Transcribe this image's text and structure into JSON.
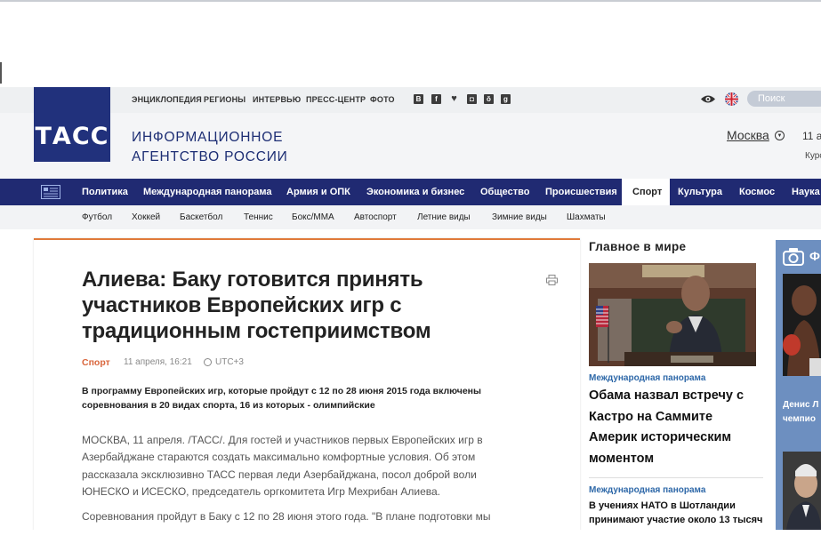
{
  "header": {
    "logo_text": "ТАСС",
    "agency_line1": "ИНФОРМАЦИОННОЕ",
    "agency_line2": "АГЕНТСТВО РОССИИ",
    "top_links": [
      "ЭНЦИКЛОПЕДИЯ",
      "РЕГИОНЫ",
      "ИНТЕРВЬЮ",
      "ПРЕСС-ЦЕНТР",
      "ФОТО"
    ],
    "social_icons": [
      "vk-icon",
      "facebook-icon",
      "twitter-icon",
      "instagram-icon",
      "odnoklassniki-icon",
      "google-plus-icon"
    ],
    "search_placeholder": "Поиск",
    "city": "Москва",
    "date": "11 а",
    "rates": "Курс"
  },
  "nav": {
    "items": [
      "Политика",
      "Международная панорама",
      "Армия и ОПК",
      "Экономика и бизнес",
      "Общество",
      "Происшествия",
      "Спорт",
      "Культура",
      "Космос",
      "Наука"
    ],
    "active": "Спорт"
  },
  "subnav": {
    "items": [
      "Футбол",
      "Хоккей",
      "Баскетбол",
      "Теннис",
      "Бокс/ММА",
      "Автоспорт",
      "Летние виды",
      "Зимние виды",
      "Шахматы"
    ]
  },
  "article": {
    "title": "Алиева: Баку готовится принять участников Европейских игр с традиционным гостеприимством",
    "category": "Спорт",
    "date": "11 апреля, 16:21",
    "timezone": "UTC+3",
    "lead": "В программу Европейских игр, которые пройдут с 12 по 28 июня 2015 года включены соревнования в 20 видах спорта, 16 из которых - олимпийские",
    "paragraph1": "МОСКВА, 11 апреля. /ТАСС/. Для гостей и участников первых Европейских игр в Азербайджане стараются создать максимально комфортные условия. Об этом рассказала эксклюзивно ТАСС первая леди Азербайджана, посол доброй воли ЮНЕСКО и ИСЕСКО, председатель оргкомитета Игр Мехрибан Алиева.",
    "paragraph2": "Соревнования пройдут в Баку с 12 по 28 июня этого года. \"В плане подготовки мы"
  },
  "sidebar": {
    "heading": "Главное в мире",
    "news": [
      {
        "category": "Международная панорама",
        "headline": "Обама назвал встречу с Кастро на Саммите Америк историческим моментом"
      },
      {
        "category": "Международная панорама",
        "headline": "В учениях НАТО в Шотландии принимают участие около 13 тысяч"
      }
    ]
  },
  "photo_panel": {
    "label": "Ф",
    "caption": "Денис Л\nчемпио"
  },
  "colors": {
    "brand_blue": "#21317c",
    "nav_blue": "#202a72",
    "accent_orange": "#e07a3a",
    "link_blue": "#2e68a8"
  }
}
